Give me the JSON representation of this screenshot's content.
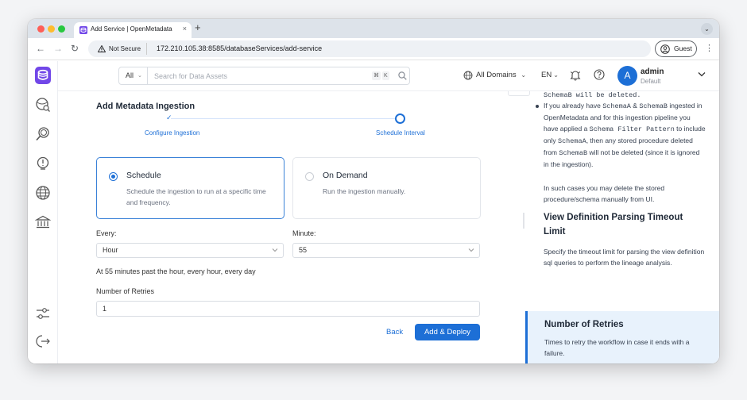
{
  "browser": {
    "tab_title": "Add Service | OpenMetadata",
    "tab_close": "×",
    "new_tab": "+",
    "menu_chevron": "⌄",
    "security_label": "Not Secure",
    "url": "172.210.105.38:8585/databaseServices/add-service",
    "profile_label": "Guest",
    "more_menu": "⋮",
    "back": "←",
    "forward": "→",
    "reload": "↻"
  },
  "topbar": {
    "search_scope": "All",
    "search_placeholder": "Search for Data Assets",
    "kbd_cmd": "⌘",
    "kbd_key": "K",
    "domains_label": "All Domains",
    "language": "EN",
    "avatar_initial": "A",
    "user_name": "admin",
    "user_role": "Default"
  },
  "sidebar": {
    "items": [
      "explore-icon",
      "data-quality-icon",
      "insights-icon",
      "domains-icon",
      "governance-icon",
      "settings-icon",
      "logout-icon"
    ]
  },
  "main": {
    "title": "Add Metadata Ingestion",
    "steps": [
      {
        "label": "Configure Ingestion",
        "status": "done"
      },
      {
        "label": "Schedule Interval",
        "status": "active"
      }
    ],
    "options": [
      {
        "title": "Schedule",
        "desc": "Schedule the ingestion to run at a specific time and frequency.",
        "selected": true
      },
      {
        "title": "On Demand",
        "desc": "Run the ingestion manually.",
        "selected": false
      }
    ],
    "every_label": "Every:",
    "every_value": "Hour",
    "minute_label": "Minute:",
    "minute_value": "55",
    "cron_description": "At 55 minutes past the hour, every hour, every day",
    "retries_label": "Number of Retries",
    "retries_value": "1",
    "back_label": "Back",
    "deploy_label": "Add & Deploy"
  },
  "help_panel": {
    "top_cut": "SchemaB will be deleted.",
    "bullet_parts": [
      "If you already have ",
      "SchemaA",
      " & ",
      "SchemaB",
      " ingested in OpenMetadata and for this ingestion pipeline you have applied a ",
      "Schema Filter Pattern",
      " to include only ",
      "SchemaA",
      ", then any stored procedure deleted from ",
      "SchemaB",
      " will not be deleted (since it is ignored in the ingestion)."
    ],
    "note": "In such cases you may delete the stored procedure/schema manually from UI.",
    "section1_title": "View Definition Parsing Timeout Limit",
    "section1_text": "Specify the timeout limit for parsing the view definition sql queries to perform the lineage analysis.",
    "section2_title": "Number of Retries",
    "section2_text": "Times to retry the workflow in case it ends with a failure."
  },
  "colors": {
    "accent": "#1d6fd6",
    "highlight_bg": "#e8f2fc",
    "tab_strip": "#dde3ea"
  }
}
